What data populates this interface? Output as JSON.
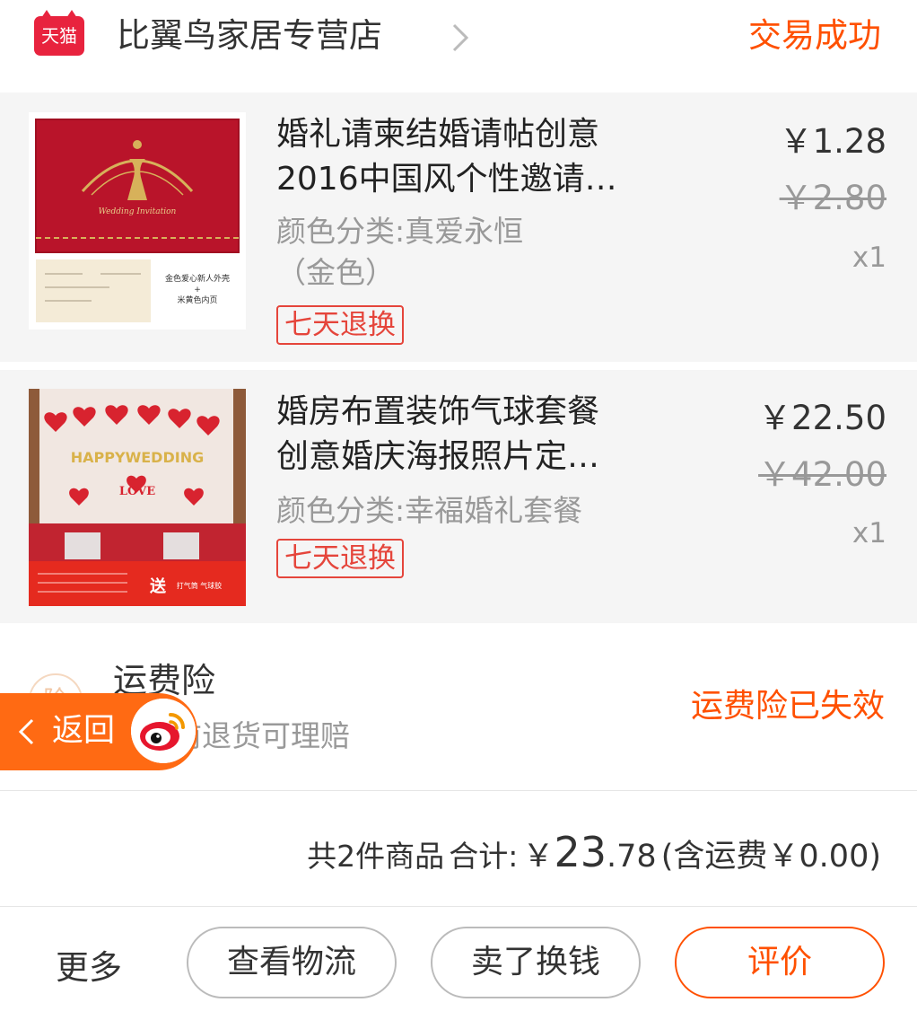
{
  "header": {
    "logo_text": "天猫",
    "shop_name": "比翼鸟家居专营店",
    "status": "交易成功"
  },
  "items": [
    {
      "title_line1": "婚礼请柬结婚请帖创意",
      "title_line2": "2016中国风个性邀请…",
      "sku_line1": "颜色分类:真爱永恒",
      "sku_line2": "（金色）",
      "badge": "七天退换",
      "price": "￥1.28",
      "original_price": "￥2.80",
      "quantity": "x1",
      "thumbnail_text": [
        "Wedding Invitation",
        "金色爱心新人外壳",
        "+",
        "米黄色内页"
      ]
    },
    {
      "title_line1": "婚房布置装饰气球套餐",
      "title_line2": "创意婚庆海报照片定…",
      "sku_line1": "颜色分类:幸福婚礼套餐",
      "badge": "七天退换",
      "price": "￥22.50",
      "original_price": "￥42.00",
      "quantity": "x1",
      "thumbnail_text": [
        "HAPPYWEDDING",
        "LOVE",
        "送",
        "打气筒 气球胶"
      ]
    }
  ],
  "insurance": {
    "icon_text": "险",
    "title": "运费险",
    "description": "收货前退货可理赔",
    "status": "运费险已失效"
  },
  "back_button": {
    "label": "返回"
  },
  "summary": {
    "count_text": "共2件商品",
    "total_label": "合计:",
    "currency": "￥",
    "total_integer": "23",
    "total_decimal": ".78",
    "shipping": "(含运费￥0.00)"
  },
  "actions": {
    "more": "更多",
    "logistics": "查看物流",
    "resell": "卖了换钱",
    "review": "评价"
  },
  "colors": {
    "accent": "#ff5000",
    "badge_red": "#e5453b",
    "tmall_red": "#e8233e",
    "back_orange": "#ff6a13"
  }
}
